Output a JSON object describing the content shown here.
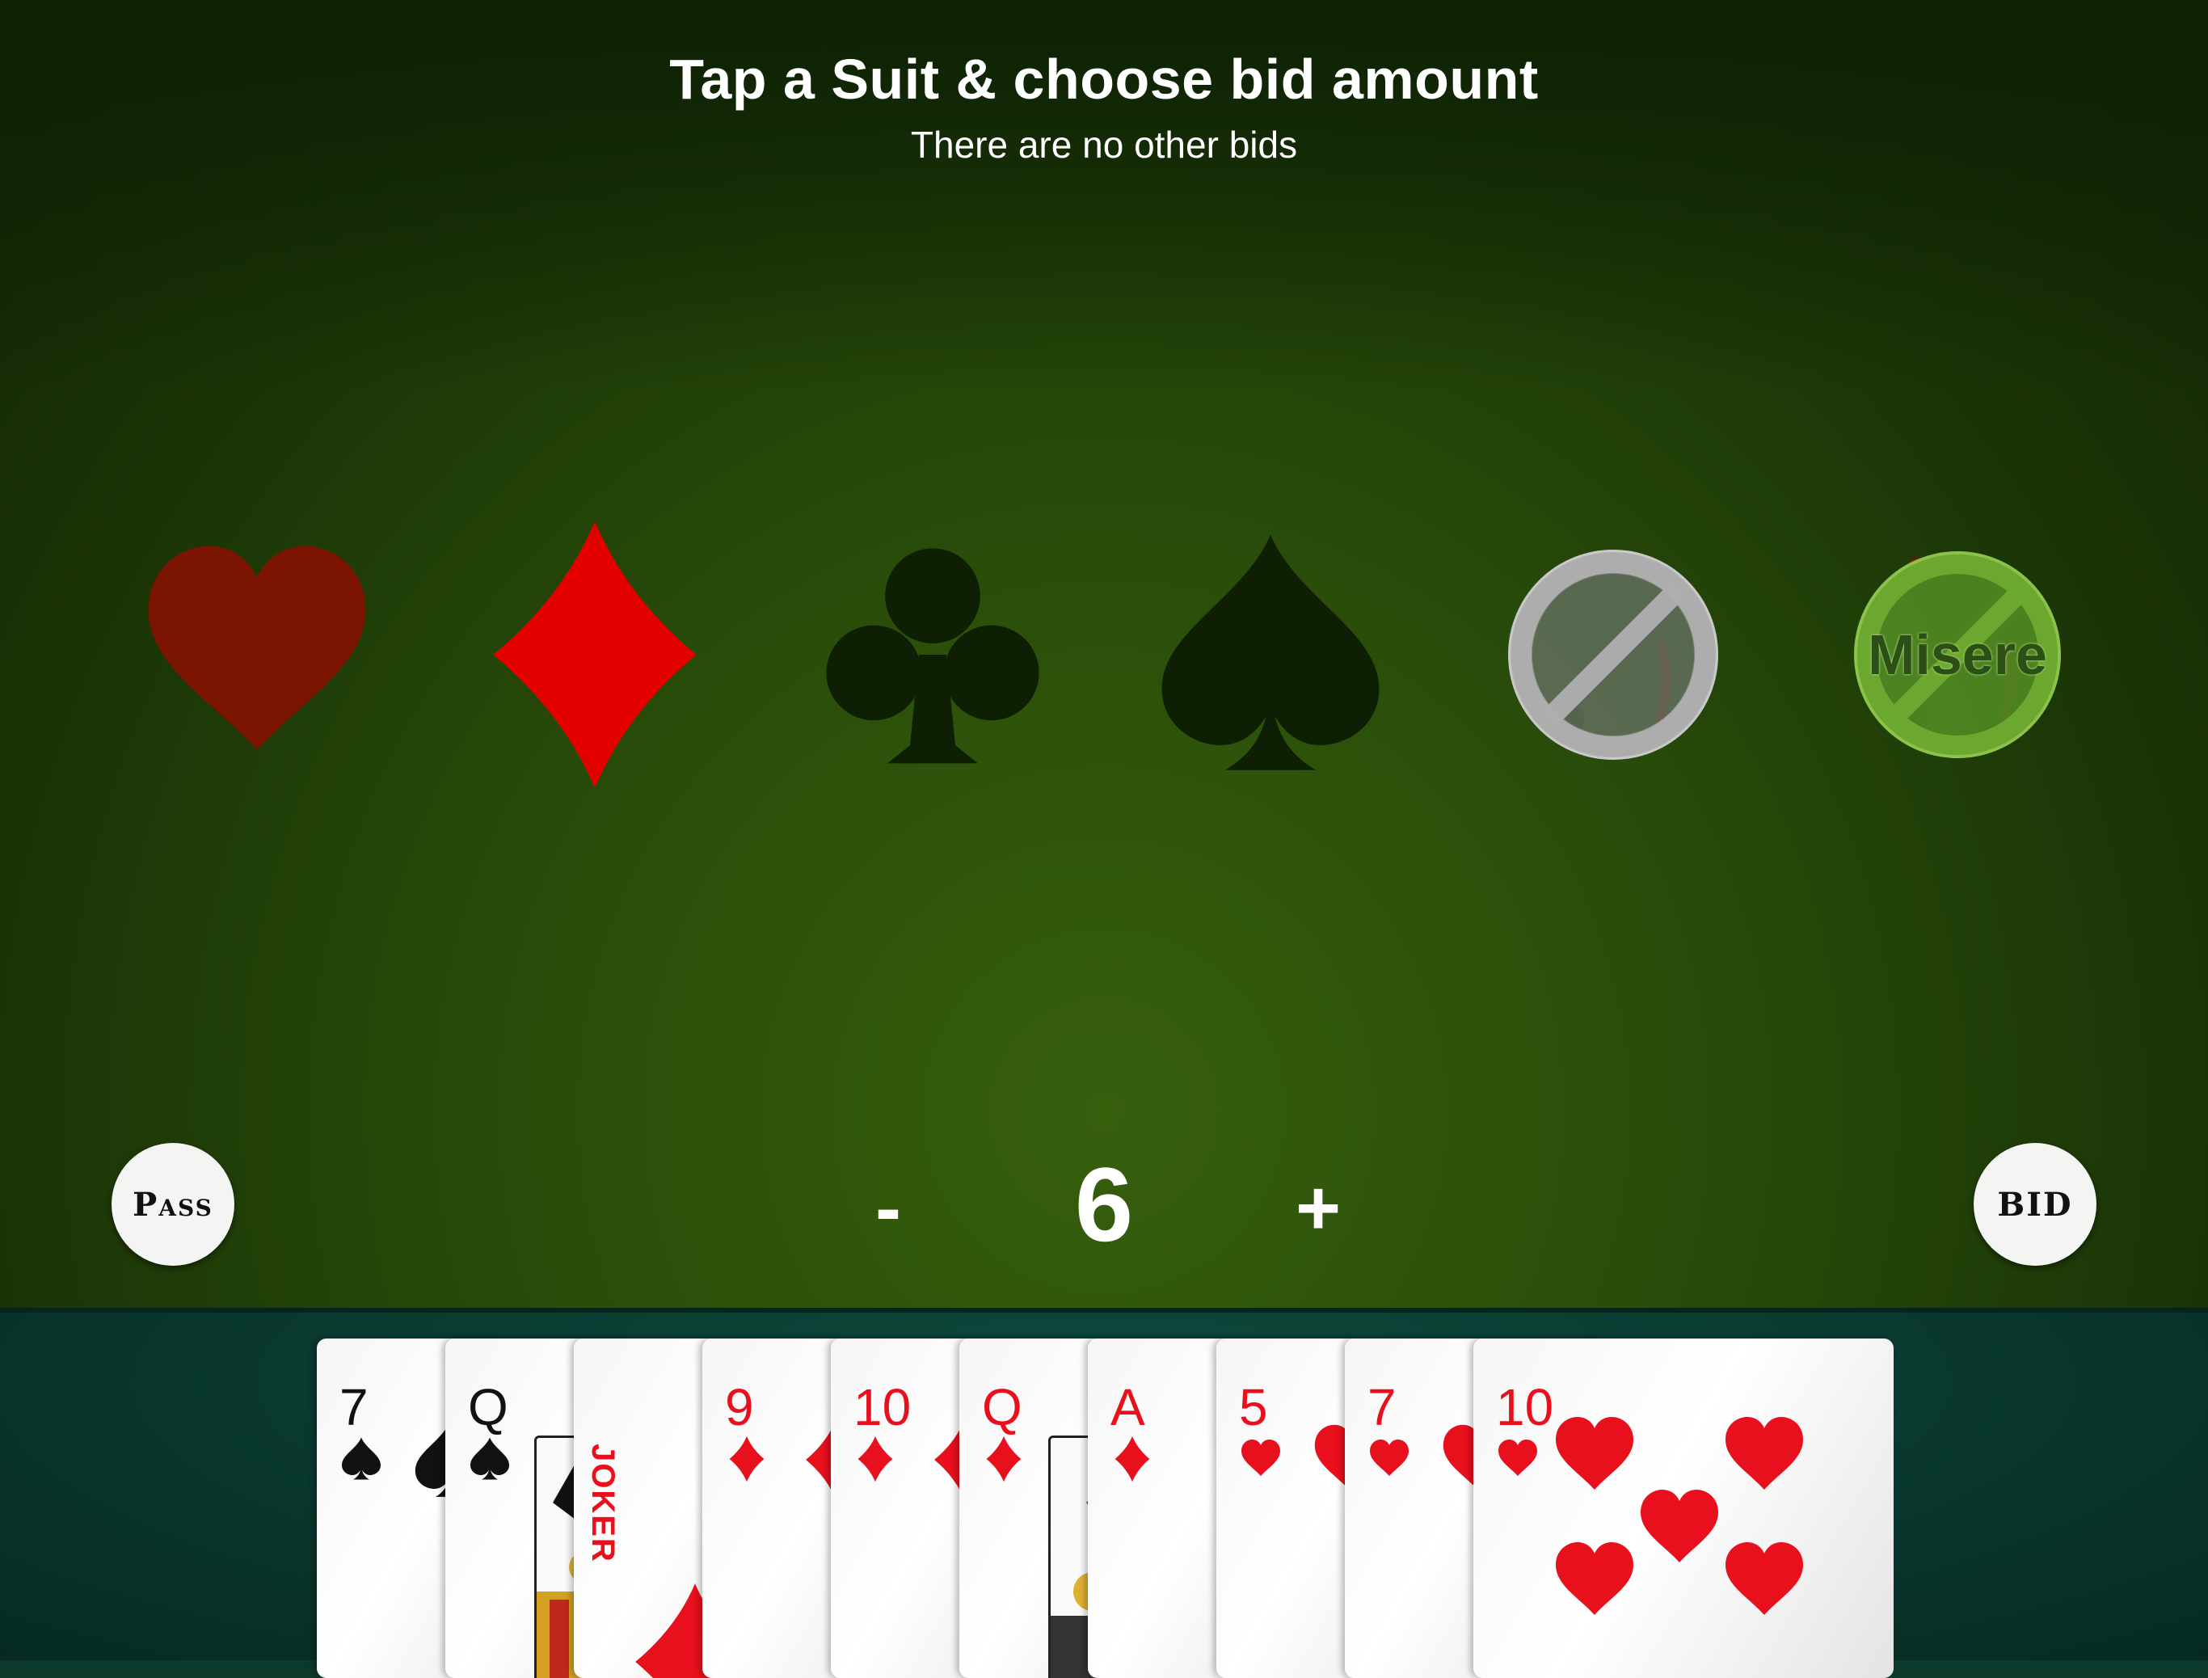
{
  "header": {
    "title": "Tap a Suit & choose bid amount",
    "subtitle": "There are no other bids"
  },
  "suits": [
    {
      "name": "hearts",
      "color": "#7b1400"
    },
    {
      "name": "diamonds",
      "color": "#e50000"
    },
    {
      "name": "clubs",
      "color": "#0f1f03"
    },
    {
      "name": "spades",
      "color": "#0f1f03"
    }
  ],
  "no_trumps_icon": "no-trumps-icon",
  "misere": {
    "label": "Misere"
  },
  "controls": {
    "pass_label": "Pass",
    "bid_label": "BID",
    "minus_label": "-",
    "plus_label": "+",
    "bid_amount": "6"
  },
  "hand": [
    {
      "rank": "7",
      "suit": "spades",
      "color": "black"
    },
    {
      "rank": "Q",
      "suit": "spades",
      "color": "black"
    },
    {
      "rank": "JOKER",
      "suit": "joker",
      "color": "red"
    },
    {
      "rank": "9",
      "suit": "diamonds",
      "color": "red"
    },
    {
      "rank": "10",
      "suit": "diamonds",
      "color": "red"
    },
    {
      "rank": "Q",
      "suit": "diamonds",
      "color": "red"
    },
    {
      "rank": "A",
      "suit": "diamonds",
      "color": "red"
    },
    {
      "rank": "5",
      "suit": "hearts",
      "color": "red"
    },
    {
      "rank": "7",
      "suit": "hearts",
      "color": "red"
    },
    {
      "rank": "10",
      "suit": "hearts",
      "color": "red"
    }
  ]
}
